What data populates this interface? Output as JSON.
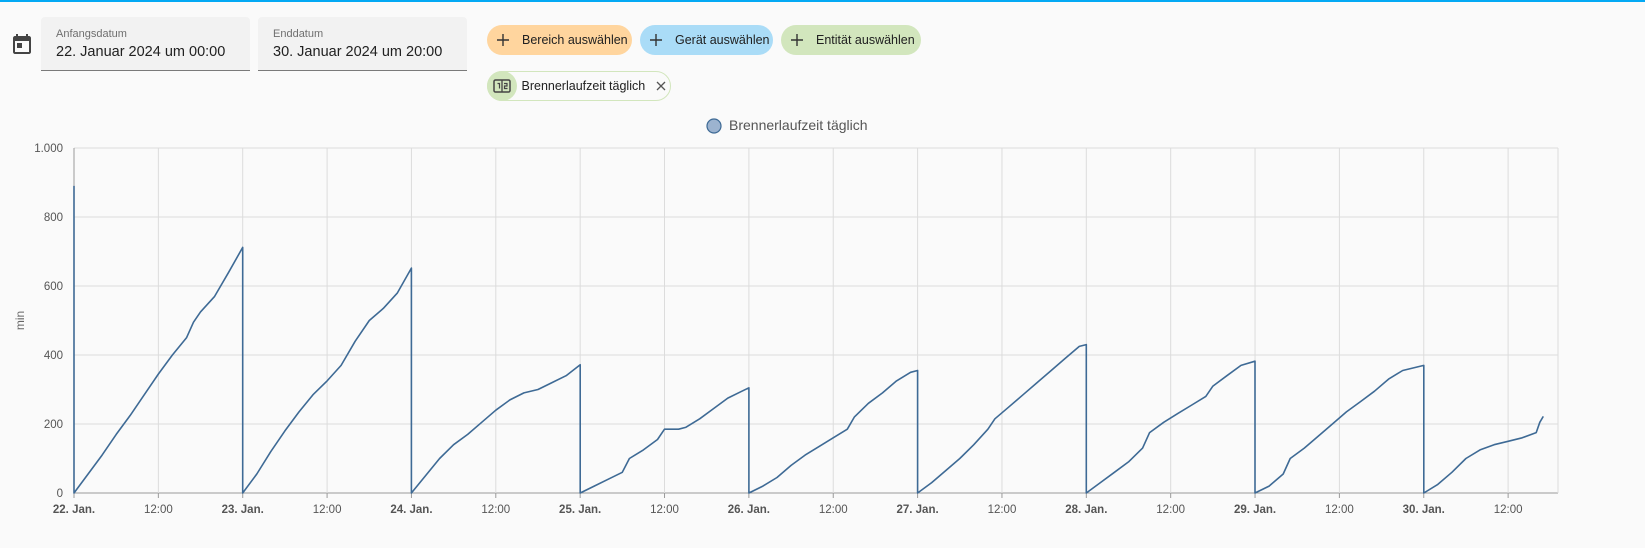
{
  "colors": {
    "accent": "#03a9f4",
    "series": "#3e6a95",
    "legend_fill": "#9cb3cf",
    "area_chip": "#ffd59e",
    "device_chip": "#aadcf7",
    "entity_chip": "#d2e6bd"
  },
  "date_range": {
    "start_label": "Anfangsdatum",
    "start_value": "22. Januar 2024 um 00:00",
    "end_label": "Enddatum",
    "end_value": "30. Januar 2024 um 20:00"
  },
  "pickers": {
    "area": "Bereich auswählen",
    "device": "Gerät auswählen",
    "entity": "Entität auswählen"
  },
  "selected_entity": {
    "label": "Brennerlaufzeit täglich",
    "icon": "counter-icon"
  },
  "chart_data": {
    "type": "line",
    "ylabel": "min",
    "ylim": [
      0,
      1000
    ],
    "yticks": [
      0,
      200,
      400,
      600,
      800,
      1000
    ],
    "ytick_labels": [
      "0",
      "200",
      "400",
      "600",
      "800",
      "1.000"
    ],
    "x_range_hours": [
      0,
      209
    ],
    "xticks": [
      {
        "h": 0,
        "label": "22. Jan.",
        "bold": true
      },
      {
        "h": 12,
        "label": "12:00",
        "bold": false
      },
      {
        "h": 24,
        "label": "23. Jan.",
        "bold": true
      },
      {
        "h": 36,
        "label": "12:00",
        "bold": false
      },
      {
        "h": 48,
        "label": "24. Jan.",
        "bold": true
      },
      {
        "h": 60,
        "label": "12:00",
        "bold": false
      },
      {
        "h": 72,
        "label": "25. Jan.",
        "bold": true
      },
      {
        "h": 84,
        "label": "12:00",
        "bold": false
      },
      {
        "h": 96,
        "label": "26. Jan.",
        "bold": true
      },
      {
        "h": 108,
        "label": "12:00",
        "bold": false
      },
      {
        "h": 120,
        "label": "27. Jan.",
        "bold": true
      },
      {
        "h": 132,
        "label": "12:00",
        "bold": false
      },
      {
        "h": 144,
        "label": "28. Jan.",
        "bold": true
      },
      {
        "h": 156,
        "label": "12:00",
        "bold": false
      },
      {
        "h": 168,
        "label": "29. Jan.",
        "bold": true
      },
      {
        "h": 180,
        "label": "12:00",
        "bold": false
      },
      {
        "h": 192,
        "label": "30. Jan.",
        "bold": true
      },
      {
        "h": 204,
        "label": "12:00",
        "bold": false
      }
    ],
    "legend": [
      "Brennerlaufzeit täglich"
    ],
    "series": [
      {
        "name": "Brennerlaufzeit täglich",
        "points": [
          [
            0,
            890
          ],
          [
            0,
            0
          ],
          [
            2,
            55
          ],
          [
            4,
            110
          ],
          [
            6,
            170
          ],
          [
            8,
            225
          ],
          [
            10,
            285
          ],
          [
            12,
            345
          ],
          [
            14,
            400
          ],
          [
            16,
            450
          ],
          [
            17,
            495
          ],
          [
            18,
            525
          ],
          [
            20,
            570
          ],
          [
            22,
            640
          ],
          [
            24,
            712
          ],
          [
            24,
            0
          ],
          [
            26,
            55
          ],
          [
            28,
            120
          ],
          [
            30,
            180
          ],
          [
            32,
            235
          ],
          [
            34,
            285
          ],
          [
            36,
            325
          ],
          [
            38,
            370
          ],
          [
            40,
            440
          ],
          [
            42,
            500
          ],
          [
            44,
            535
          ],
          [
            46,
            580
          ],
          [
            48,
            652
          ],
          [
            48,
            0
          ],
          [
            50,
            50
          ],
          [
            52,
            100
          ],
          [
            54,
            140
          ],
          [
            56,
            170
          ],
          [
            58,
            205
          ],
          [
            60,
            240
          ],
          [
            62,
            270
          ],
          [
            64,
            290
          ],
          [
            66,
            300
          ],
          [
            68,
            320
          ],
          [
            70,
            340
          ],
          [
            72,
            372
          ],
          [
            72,
            0
          ],
          [
            74,
            20
          ],
          [
            76,
            40
          ],
          [
            78,
            60
          ],
          [
            79,
            100
          ],
          [
            81,
            125
          ],
          [
            83,
            155
          ],
          [
            84,
            185
          ],
          [
            86,
            185
          ],
          [
            87,
            190
          ],
          [
            89,
            215
          ],
          [
            91,
            245
          ],
          [
            93,
            275
          ],
          [
            95,
            295
          ],
          [
            96,
            305
          ],
          [
            96,
            0
          ],
          [
            98,
            20
          ],
          [
            100,
            45
          ],
          [
            102,
            80
          ],
          [
            104,
            110
          ],
          [
            106,
            135
          ],
          [
            108,
            160
          ],
          [
            110,
            185
          ],
          [
            111,
            220
          ],
          [
            113,
            260
          ],
          [
            115,
            290
          ],
          [
            117,
            325
          ],
          [
            119,
            350
          ],
          [
            120,
            355
          ],
          [
            120,
            0
          ],
          [
            122,
            30
          ],
          [
            124,
            65
          ],
          [
            126,
            100
          ],
          [
            128,
            140
          ],
          [
            130,
            185
          ],
          [
            131,
            215
          ],
          [
            133,
            250
          ],
          [
            135,
            285
          ],
          [
            137,
            320
          ],
          [
            139,
            355
          ],
          [
            141,
            390
          ],
          [
            143,
            425
          ],
          [
            144,
            430
          ],
          [
            144,
            0
          ],
          [
            146,
            30
          ],
          [
            148,
            60
          ],
          [
            150,
            90
          ],
          [
            152,
            130
          ],
          [
            153,
            175
          ],
          [
            155,
            205
          ],
          [
            157,
            230
          ],
          [
            159,
            255
          ],
          [
            161,
            280
          ],
          [
            162,
            310
          ],
          [
            164,
            340
          ],
          [
            166,
            370
          ],
          [
            168,
            382
          ],
          [
            168,
            0
          ],
          [
            170,
            20
          ],
          [
            172,
            55
          ],
          [
            173,
            100
          ],
          [
            175,
            130
          ],
          [
            177,
            165
          ],
          [
            179,
            200
          ],
          [
            181,
            235
          ],
          [
            183,
            265
          ],
          [
            185,
            295
          ],
          [
            187,
            330
          ],
          [
            189,
            355
          ],
          [
            192,
            370
          ],
          [
            192,
            0
          ],
          [
            194,
            25
          ],
          [
            196,
            60
          ],
          [
            198,
            100
          ],
          [
            200,
            125
          ],
          [
            202,
            140
          ],
          [
            204,
            150
          ],
          [
            206,
            160
          ],
          [
            208,
            175
          ],
          [
            208.5,
            205
          ],
          [
            209,
            222
          ]
        ]
      }
    ]
  }
}
